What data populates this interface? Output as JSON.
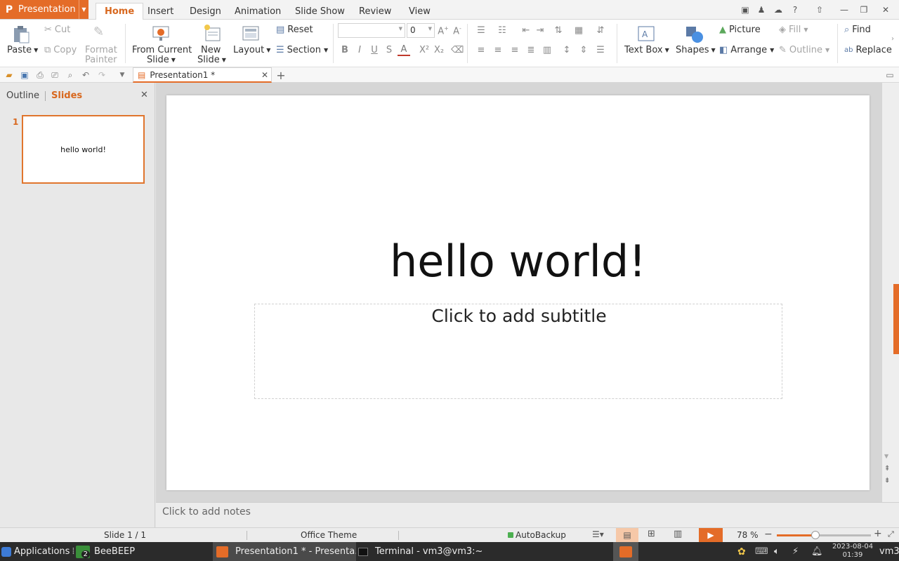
{
  "app": {
    "name": "Presentation",
    "menu_tabs": [
      "Home",
      "Insert",
      "Design",
      "Animation",
      "Slide Show",
      "Review",
      "View"
    ],
    "active_tab": "Home"
  },
  "ribbon": {
    "paste": "Paste",
    "cut": "Cut",
    "copy": "Copy",
    "format_painter_1": "Format",
    "format_painter_2": "Painter",
    "from_current_1": "From Current",
    "from_current_2": "Slide",
    "new_slide_1": "New",
    "new_slide_2": "Slide",
    "layout": "Layout",
    "reset": "Reset",
    "section": "Section",
    "font_name_value": "",
    "font_size_value": "0",
    "text_box": "Text Box",
    "shapes": "Shapes",
    "picture": "Picture",
    "arrange": "Arrange",
    "fill": "Fill",
    "outline": "Outline",
    "find": "Find",
    "replace": "Replace"
  },
  "document_tab": {
    "title": "Presentation1 *"
  },
  "left_panel": {
    "outline_tab": "Outline",
    "slides_tab": "Slides",
    "slide_number": "1",
    "thumb_text": "hello world!"
  },
  "slide": {
    "title": "hello world!",
    "subtitle_placeholder": "Click to add subtitle"
  },
  "notes": {
    "placeholder": "Click to add notes"
  },
  "statusbar": {
    "slide_counter": "Slide 1 / 1",
    "theme": "Office Theme",
    "autobackup": "AutoBackup",
    "zoom": "78 %",
    "zoom_fraction": 0.78
  },
  "taskbar": {
    "applications": "Applications",
    "beebeep": "BeeBEEP",
    "beebeep_badge": "2",
    "presentation_window": "Presentation1 * - Presenta...",
    "terminal_window": "Terminal - vm3@vm3:~",
    "date": "2023-08-04",
    "time": "01:39",
    "user": "vm3"
  },
  "colors": {
    "accent": "#e46c28",
    "taskbar": "#2b2b2b"
  }
}
